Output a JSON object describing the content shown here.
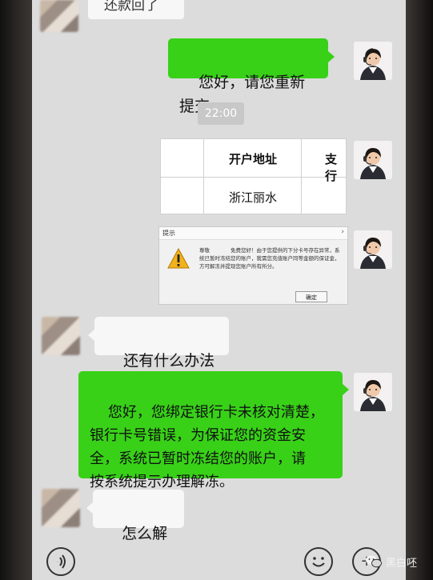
{
  "chat": {
    "top_partial_text": "还款回了",
    "messages": [
      {
        "side": "right",
        "text": "您好，请您重新提交。"
      },
      {
        "side": "left",
        "text": "还有什么办法吗"
      },
      {
        "side": "right",
        "text": "您好，您绑定银行卡未核对清楚，\n银行卡号错误，为保证您的资金安\n全，系统已暂时冻结您的账户，请\n按系统提示办理解冻。"
      },
      {
        "side": "left",
        "text": "怎么解冻"
      }
    ],
    "time_label": "22:00",
    "table_image": {
      "header_1": "开户地址",
      "header_2": "支行",
      "cell_1": "浙江丽水"
    },
    "dialog_image": {
      "title": "提示",
      "close": "›",
      "body": "尊敬　　　　免费您好！由于您提供的下分卡号存在异常，系统已暂时冻结您的账户，我需您充值账户同等金额的保证金，方可解冻并提现您账户所有所分。",
      "button": "确定"
    }
  },
  "input_bar": {
    "voice_icon": "voice-icon",
    "emoji_icon": "emoji-icon",
    "plus_label": "+"
  },
  "watermark": {
    "text": "黑白呸"
  },
  "colors": {
    "green_bubble": "#38d118",
    "white_bubble": "#f7f7f7",
    "screen_bg": "#dcdcdc"
  }
}
